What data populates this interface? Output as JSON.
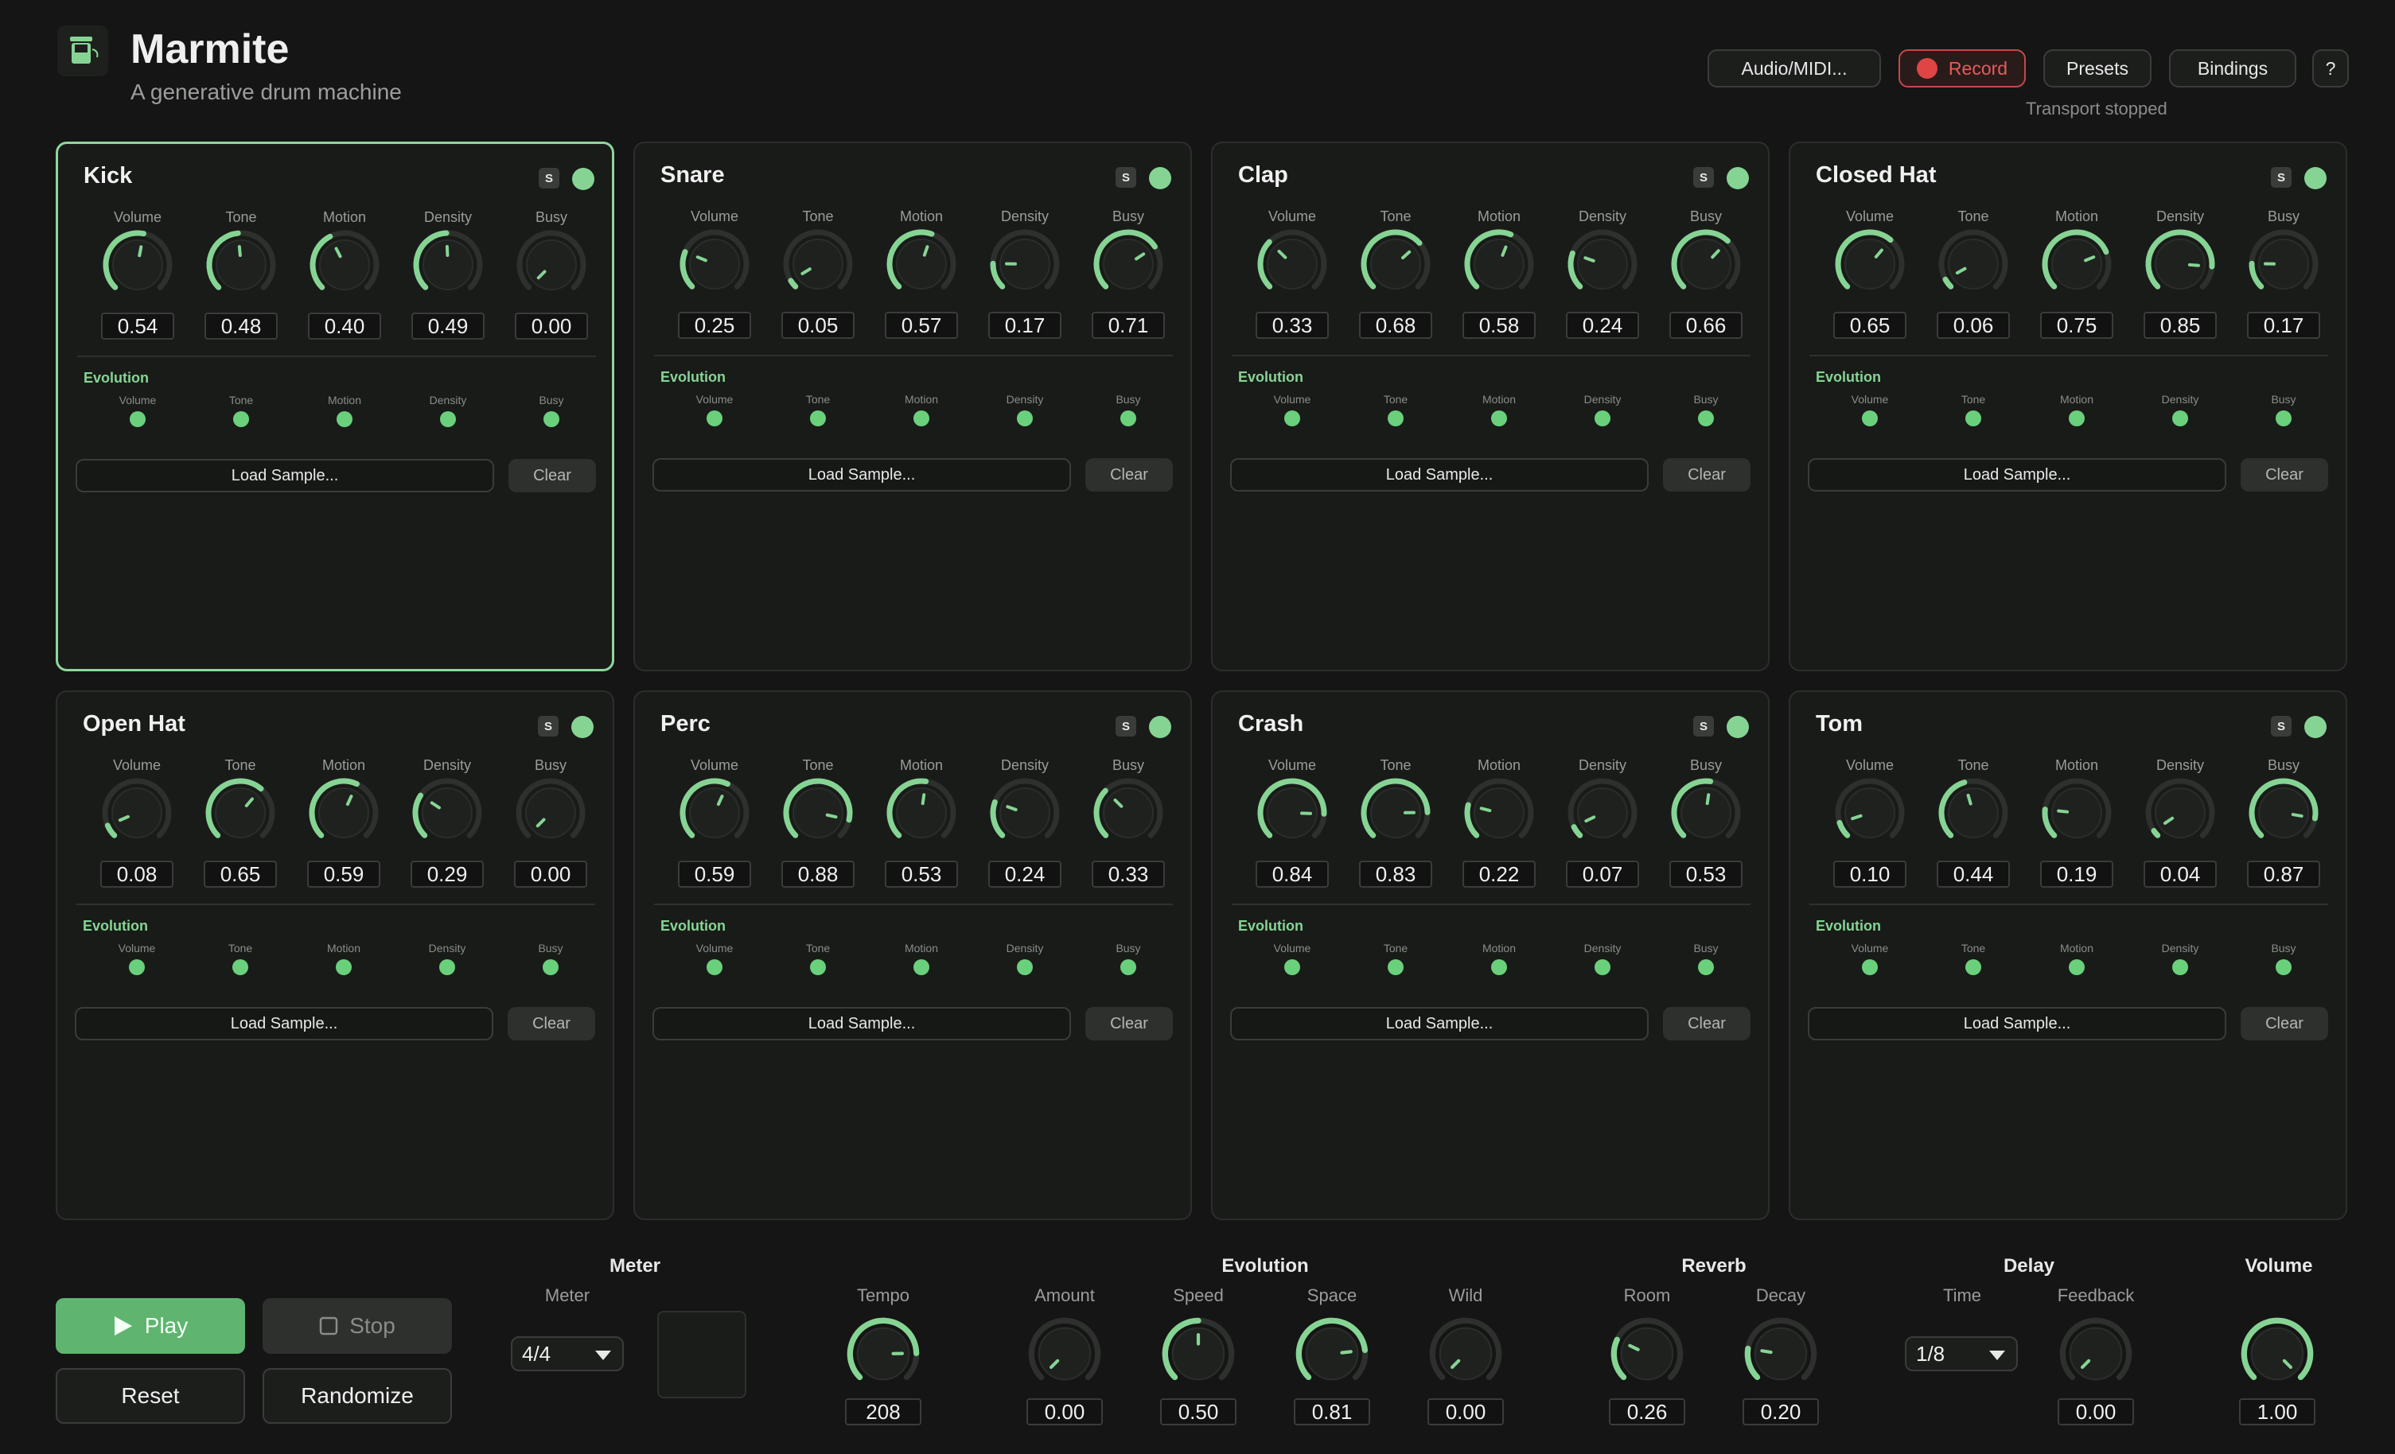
{
  "app": {
    "title": "Marmite",
    "subtitle": "A generative drum machine"
  },
  "header": {
    "audio_midi": "Audio/MIDI...",
    "record": "Record",
    "presets": "Presets",
    "bindings": "Bindings",
    "help": "?",
    "transport_status": "Transport stopped"
  },
  "colors": {
    "accent": "#86d494",
    "record": "#e04545",
    "background": "#141514",
    "panel": "#191b19"
  },
  "labels": {
    "solo": "S",
    "evolution": "Evolution",
    "load_sample": "Load Sample...",
    "clear": "Clear",
    "params": [
      "Volume",
      "Tone",
      "Motion",
      "Density",
      "Busy"
    ]
  },
  "tracks": [
    {
      "name": "Kick",
      "selected": true,
      "values": [
        "0.54",
        "0.48",
        "0.40",
        "0.49",
        "0.00"
      ]
    },
    {
      "name": "Snare",
      "selected": false,
      "values": [
        "0.25",
        "0.05",
        "0.57",
        "0.17",
        "0.71"
      ]
    },
    {
      "name": "Clap",
      "selected": false,
      "values": [
        "0.33",
        "0.68",
        "0.58",
        "0.24",
        "0.66"
      ]
    },
    {
      "name": "Closed Hat",
      "selected": false,
      "values": [
        "0.65",
        "0.06",
        "0.75",
        "0.85",
        "0.17"
      ]
    },
    {
      "name": "Open Hat",
      "selected": false,
      "values": [
        "0.08",
        "0.65",
        "0.59",
        "0.29",
        "0.00"
      ]
    },
    {
      "name": "Perc",
      "selected": false,
      "values": [
        "0.59",
        "0.88",
        "0.53",
        "0.24",
        "0.33"
      ]
    },
    {
      "name": "Crash",
      "selected": false,
      "values": [
        "0.84",
        "0.83",
        "0.22",
        "0.07",
        "0.53"
      ]
    },
    {
      "name": "Tom",
      "selected": false,
      "values": [
        "0.10",
        "0.44",
        "0.19",
        "0.04",
        "0.87"
      ]
    }
  ],
  "bottom": {
    "play": "Play",
    "stop": "Stop",
    "reset": "Reset",
    "randomize": "Randomize",
    "meter_section": "Meter",
    "meter_label": "Meter",
    "meter_value": "4/4",
    "tempo_label": "Tempo",
    "tempo_value": "208",
    "tempo_fraction": 0.83,
    "evolution_section": "Evolution",
    "amount_label": "Amount",
    "amount_value": "0.00",
    "speed_label": "Speed",
    "speed_value": "0.50",
    "space_label": "Space",
    "space_value": "0.81",
    "wild_label": "Wild",
    "wild_value": "0.00",
    "reverb_section": "Reverb",
    "room_label": "Room",
    "room_value": "0.26",
    "decay_label": "Decay",
    "decay_value": "0.20",
    "delay_section": "Delay",
    "time_label": "Time",
    "time_value": "1/8",
    "feedback_label": "Feedback",
    "feedback_value": "0.00",
    "volume_section": "Volume",
    "volume_value": "1.00"
  }
}
